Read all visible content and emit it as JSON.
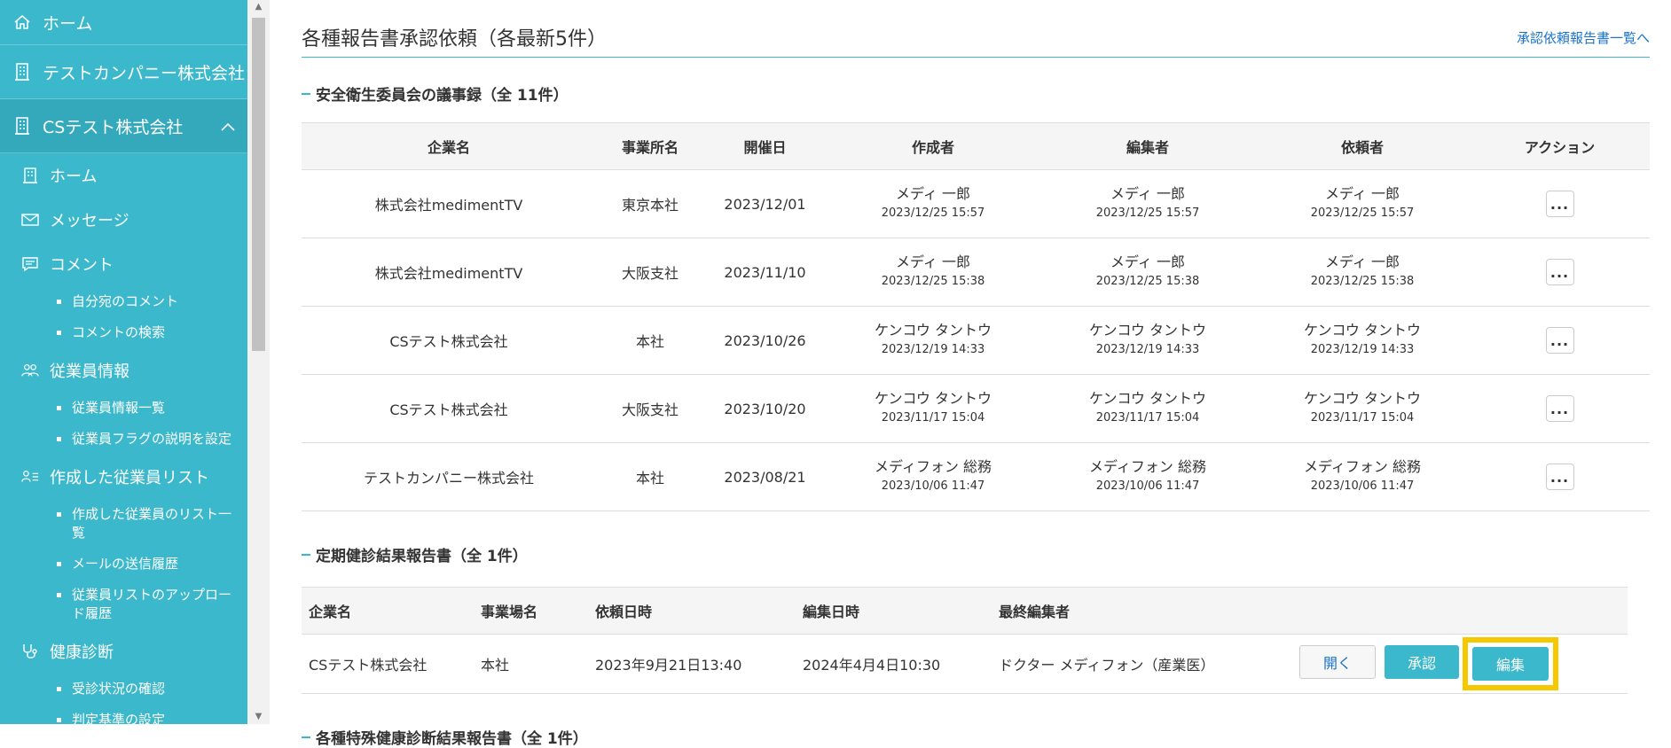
{
  "sidebar": {
    "home_top": "ホーム",
    "company1": "テストカンパニー株式会社",
    "company2": "CSテスト株式会社",
    "items": {
      "home": "ホーム",
      "message": "メッセージ",
      "comment": "コメント",
      "comment_mine": "自分宛のコメント",
      "comment_search": "コメントの検索",
      "employee": "従業員情報",
      "employee_list": "従業員情報一覧",
      "employee_flag": "従業員フラグの説明を設定",
      "created_list": "作成した従業員リスト",
      "created_list_index": "作成した従業員のリスト一覧",
      "mail_history": "メールの送信履歴",
      "upload_history": "従業員リストのアップロード履歴",
      "health": "健康診断",
      "exam_status": "受診状況の確認",
      "criteria": "判定基準の設定"
    }
  },
  "header": {
    "title": "各種報告書承認依頼（各最新5件）",
    "link": "承認依頼報告書一覧へ"
  },
  "section1": {
    "title": "安全衛生委員会の議事録（全 11件）",
    "columns": [
      "企業名",
      "事業所名",
      "開催日",
      "作成者",
      "編集者",
      "依頼者",
      "アクション"
    ],
    "rows": [
      {
        "company": "株式会社medimentTV",
        "office": "東京本社",
        "date": "2023/12/01",
        "creator": "メディ 一郎",
        "creator_time": "2023/12/25 15:57",
        "editor": "メディ 一郎",
        "editor_time": "2023/12/25 15:57",
        "requester": "メディ 一郎",
        "requester_time": "2023/12/25 15:57",
        "action": "..."
      },
      {
        "company": "株式会社medimentTV",
        "office": "大阪支社",
        "date": "2023/11/10",
        "creator": "メディ 一郎",
        "creator_time": "2023/12/25 15:38",
        "editor": "メディ 一郎",
        "editor_time": "2023/12/25 15:38",
        "requester": "メディ 一郎",
        "requester_time": "2023/12/25 15:38",
        "action": "..."
      },
      {
        "company": "CSテスト株式会社",
        "office": "本社",
        "date": "2023/10/26",
        "creator": "ケンコウ タントウ",
        "creator_time": "2023/12/19 14:33",
        "editor": "ケンコウ タントウ",
        "editor_time": "2023/12/19 14:33",
        "requester": "ケンコウ タントウ",
        "requester_time": "2023/12/19 14:33",
        "action": "..."
      },
      {
        "company": "CSテスト株式会社",
        "office": "大阪支社",
        "date": "2023/10/20",
        "creator": "ケンコウ タントウ",
        "creator_time": "2023/11/17 15:04",
        "editor": "ケンコウ タントウ",
        "editor_time": "2023/11/17 15:04",
        "requester": "ケンコウ タントウ",
        "requester_time": "2023/11/17 15:04",
        "action": "..."
      },
      {
        "company": "テストカンパニー株式会社",
        "office": "本社",
        "date": "2023/08/21",
        "creator": "メディフォン 総務",
        "creator_time": "2023/10/06 11:47",
        "editor": "メディフォン 総務",
        "editor_time": "2023/10/06 11:47",
        "requester": "メディフォン 総務",
        "requester_time": "2023/10/06 11:47",
        "action": "..."
      }
    ]
  },
  "section2": {
    "title": "定期健診結果報告書（全 1件）",
    "columns": [
      "企業名",
      "事業場名",
      "依頼日時",
      "編集日時",
      "最終編集者"
    ],
    "row": {
      "company": "CSテスト株式会社",
      "office": "本社",
      "requested": "2023年9月21日13:40",
      "edited": "2024年4月4日10:30",
      "last_editor": "ドクター メディフォン（産業医）"
    },
    "buttons": {
      "open": "開く",
      "approve": "承認",
      "edit": "編集"
    }
  },
  "section3": {
    "title": "各種特殊健康診断結果報告書（全 1件）"
  }
}
